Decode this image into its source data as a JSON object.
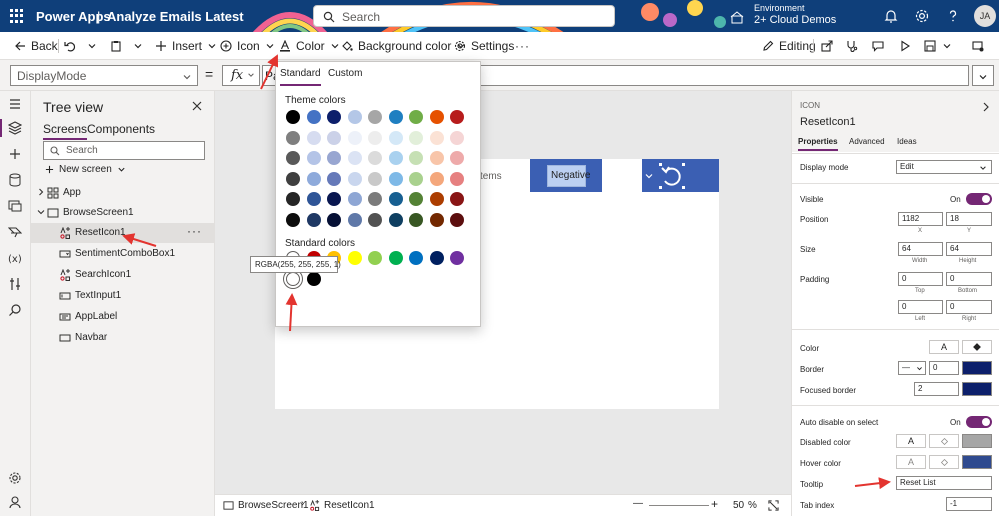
{
  "header": {
    "brand": "Power Apps",
    "separator": "|",
    "doc_title": "Analyze Emails Latest",
    "search_placeholder": "Search",
    "env_label": "Environment",
    "env_name": "2+ Cloud Demos",
    "avatar_initials": "JA"
  },
  "toolbar": {
    "back": "Back",
    "insert": "Insert",
    "icon": "Icon",
    "color": "Color",
    "background_color": "Background color",
    "settings": "Settings",
    "editing": "Editing"
  },
  "formula": {
    "property": "DisplayMode",
    "equals": "=",
    "fx": "fx",
    "value": "Pa"
  },
  "tree": {
    "title": "Tree view",
    "tabs": [
      "Screens",
      "Components"
    ],
    "search_placeholder": "Search",
    "new_screen": "New screen",
    "items": [
      {
        "label": "App"
      },
      {
        "label": "BrowseScreen1"
      },
      {
        "label": "ResetIcon1"
      },
      {
        "label": "SentimentComboBox1"
      },
      {
        "label": "SearchIcon1"
      },
      {
        "label": "TextInput1"
      },
      {
        "label": "AppLabel"
      },
      {
        "label": "Navbar"
      }
    ]
  },
  "canvas": {
    "items_text": "tems",
    "negative": "Negative"
  },
  "canvas_footer": {
    "screen": "BrowseScreen1",
    "control": "ResetIcon1",
    "minus": "—",
    "plus": "+",
    "zoom": "50",
    "zoom_unit": "%"
  },
  "color_popup": {
    "tabs": [
      "Standard",
      "Custom"
    ],
    "theme_label": "Theme colors",
    "standard_label": "Standard colors",
    "tooltip": "RGBA(255, 255, 255, 1)",
    "theme_rows": [
      [
        "#000000",
        "#4472c4",
        "#0c1f6b",
        "#b4c7e7",
        "#a6a6a6",
        "#1f7fc1",
        "#70ad47",
        "#e65100",
        "#b71c1c"
      ],
      [
        "#7f7f7f",
        "#d6dcf0",
        "#cbd1e8",
        "#edf1f9",
        "#ededed",
        "#d4e8f7",
        "#e2efda",
        "#fbe2d5",
        "#f5d5d5"
      ],
      [
        "#595959",
        "#b4c4e7",
        "#98a6d1",
        "#dbe3f4",
        "#dbdbdb",
        "#a9d1ef",
        "#c6e0b4",
        "#f8c5a9",
        "#eeaaaa"
      ],
      [
        "#3f3f3f",
        "#8eaadb",
        "#6579b9",
        "#c9d6ee",
        "#c9c9c9",
        "#7eb9e7",
        "#a9d18e",
        "#f4a77c",
        "#e68080"
      ],
      [
        "#262626",
        "#2f5597",
        "#091750",
        "#8ea6d4",
        "#7b7b7b",
        "#175f91",
        "#548235",
        "#ac3d00",
        "#891515"
      ],
      [
        "#0d0d0d",
        "#1f3864",
        "#061035",
        "#5f78a8",
        "#525252",
        "#0f3f61",
        "#385723",
        "#732800",
        "#5c0e0e"
      ]
    ],
    "standard_rows": [
      [
        "#ffffff",
        "#c00000",
        "#ffc000",
        "#ffff00",
        "#92d050",
        "#00b050",
        "#0070c0",
        "#002060",
        "#7030a0"
      ],
      [
        "#ffffff",
        "#000000"
      ]
    ]
  },
  "props": {
    "type": "ICON",
    "name": "ResetIcon1",
    "tabs": [
      "Properties",
      "Advanced",
      "Ideas"
    ],
    "display_mode_label": "Display mode",
    "display_mode_value": "Edit",
    "visible_label": "Visible",
    "visible_state": "On",
    "position_label": "Position",
    "pos_x": "1182",
    "pos_y": "18",
    "x_label": "X",
    "y_label": "Y",
    "size_label": "Size",
    "width": "64",
    "height": "64",
    "width_label": "Width",
    "height_label": "Height",
    "padding_label": "Padding",
    "pad_top": "0",
    "pad_bottom": "0",
    "pad_left": "0",
    "pad_right": "0",
    "top_label": "Top",
    "bottom_label": "Bottom",
    "left_label": "Left",
    "right_label": "Right",
    "color_label": "Color",
    "border_label": "Border",
    "border_width": "0",
    "focused_border_label": "Focused border",
    "focused_border_value": "2",
    "auto_disable_label": "Auto disable on select",
    "auto_disable_state": "On",
    "disabled_color_label": "Disabled color",
    "hover_color_label": "Hover color",
    "tooltip_label": "Tooltip",
    "tooltip_value": "Reset List",
    "tab_index_label": "Tab index",
    "tab_index_value": "-1",
    "font_glyph": "A"
  },
  "colors": {
    "accent": "#742774",
    "header": "#0f3f7a",
    "navy_swatch": "#0c1f6b",
    "disabled_swatch": "#a6a6a6",
    "hover_swatch": "#2f4a8f",
    "annotation_red": "#e3342f",
    "canvas_blue": "#3b5fb3"
  }
}
